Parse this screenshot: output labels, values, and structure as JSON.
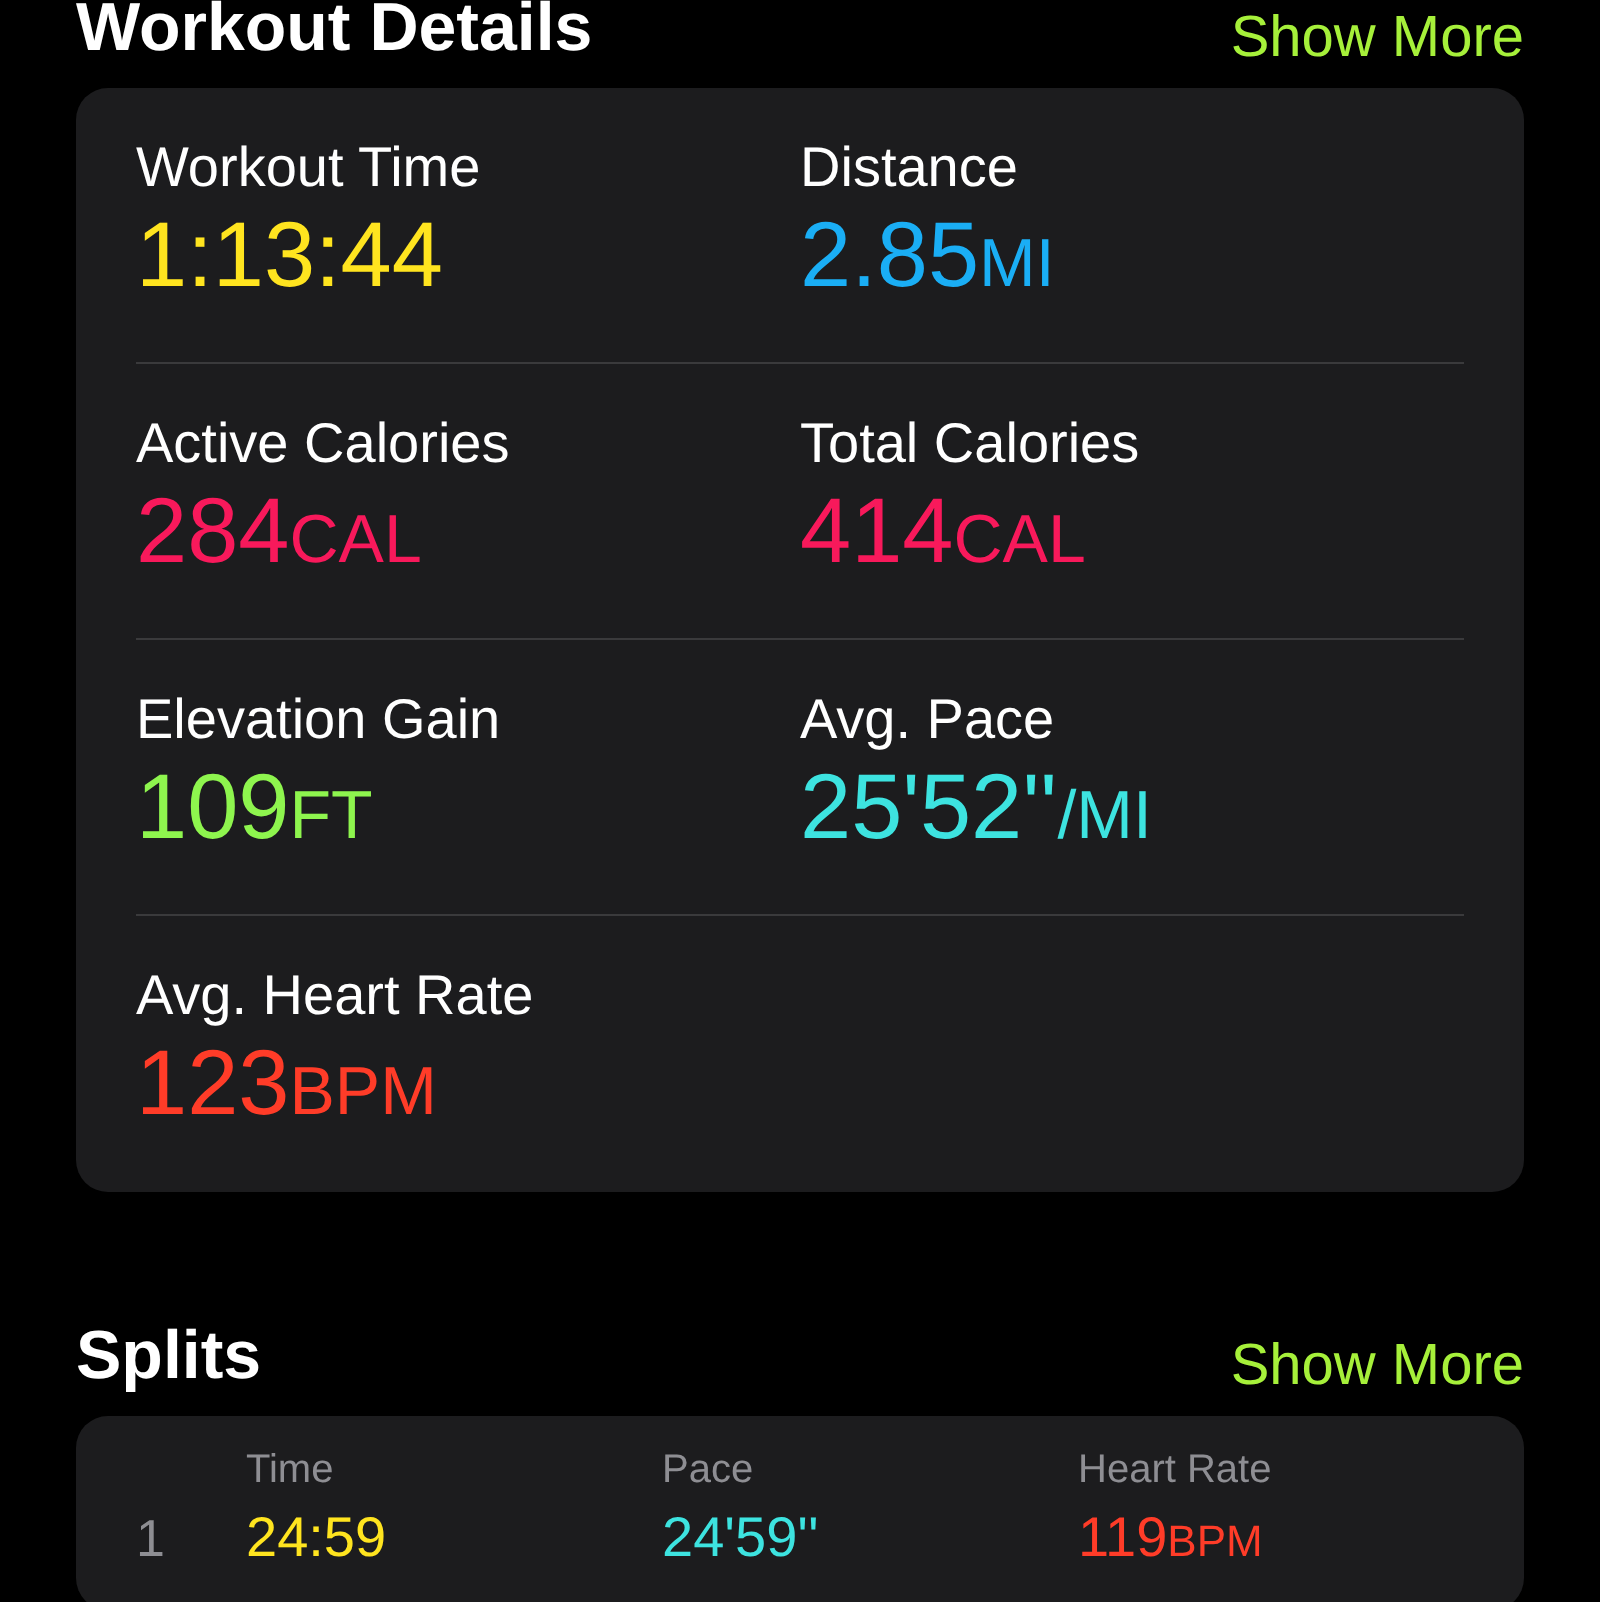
{
  "workout_details": {
    "title": "Workout Details",
    "action": "Show More",
    "metrics": [
      {
        "label": "Workout Time",
        "value": "1:13:44",
        "color": "#ffe41f"
      },
      {
        "label": "Distance",
        "value": "2.85",
        "unit": "MI",
        "color": "#1aaef5"
      },
      {
        "label": "Active Calories",
        "value": "284",
        "unit": "CAL",
        "color": "#f8195b"
      },
      {
        "label": "Total Calories",
        "value": "414",
        "unit": "CAL",
        "color": "#f8195b"
      },
      {
        "label": "Elevation Gain",
        "value": "109",
        "unit": "FT",
        "color": "#8ef54e"
      },
      {
        "label": "Avg. Pace",
        "value": "25'52''",
        "unit": "/MI",
        "color": "#3de3e0"
      },
      {
        "label": "Avg. Heart Rate",
        "value": "123",
        "unit": "BPM",
        "color": "#ff3c28"
      }
    ]
  },
  "splits": {
    "title": "Splits",
    "action": "Show More",
    "columns": [
      "Time",
      "Pace",
      "Heart Rate"
    ],
    "rows": [
      {
        "index": "1",
        "cells": [
          {
            "value": "24:59",
            "color": "#ffe41f"
          },
          {
            "value": "24'59''",
            "color": "#3de3e0"
          },
          {
            "value": "119",
            "unit": "BPM",
            "color": "#ff3c28"
          }
        ]
      }
    ]
  }
}
